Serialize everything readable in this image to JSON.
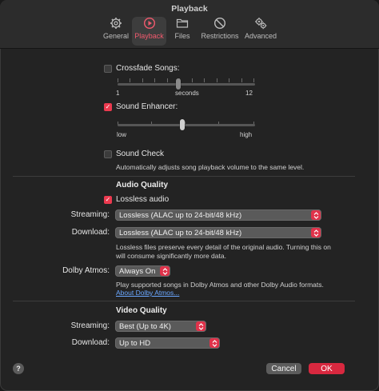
{
  "window": {
    "title": "Playback"
  },
  "toolbar": {
    "items": [
      {
        "label": "General",
        "icon": "gear-icon"
      },
      {
        "label": "Playback",
        "icon": "play-circle-icon",
        "active": true
      },
      {
        "label": "Files",
        "icon": "folder-icon"
      },
      {
        "label": "Restrictions",
        "icon": "restriction-icon"
      },
      {
        "label": "Advanced",
        "icon": "gears-icon"
      }
    ]
  },
  "crossfade": {
    "label": "Crossfade Songs:",
    "checked": false,
    "min_label": "1",
    "mid_label": "seconds",
    "max_label": "12",
    "value_seconds": 6
  },
  "sound_enhancer": {
    "label": "Sound Enhancer:",
    "checked": true,
    "low_label": "low",
    "high_label": "high",
    "level_fraction": 0.45
  },
  "sound_check": {
    "label": "Sound Check",
    "checked": false,
    "description": "Automatically adjusts song playback volume to the same level."
  },
  "audio_quality": {
    "title": "Audio Quality",
    "lossless_label": "Lossless audio",
    "lossless_checked": true,
    "streaming_label": "Streaming:",
    "streaming_value": "Lossless (ALAC up to 24-bit/48 kHz)",
    "download_label": "Download:",
    "download_value": "Lossless (ALAC up to 24-bit/48 kHz)",
    "note_line1": "Lossless files preserve every detail of the original audio. Turning this on",
    "note_line2": "will consume significantly more data.",
    "dolby_label": "Dolby Atmos:",
    "dolby_value": "Always On",
    "dolby_note": "Play supported songs in Dolby Atmos and other Dolby Audio formats.",
    "dolby_link": "About Dolby Atmos..."
  },
  "video_quality": {
    "title": "Video Quality",
    "streaming_label": "Streaming:",
    "streaming_value": "Best (Up to 4K)",
    "download_label": "Download:",
    "download_value": "Up to HD"
  },
  "footer": {
    "help": "?",
    "cancel": "Cancel",
    "ok": "OK"
  },
  "colors": {
    "accent": "#ec3a4f",
    "link": "#6aa7ff"
  }
}
